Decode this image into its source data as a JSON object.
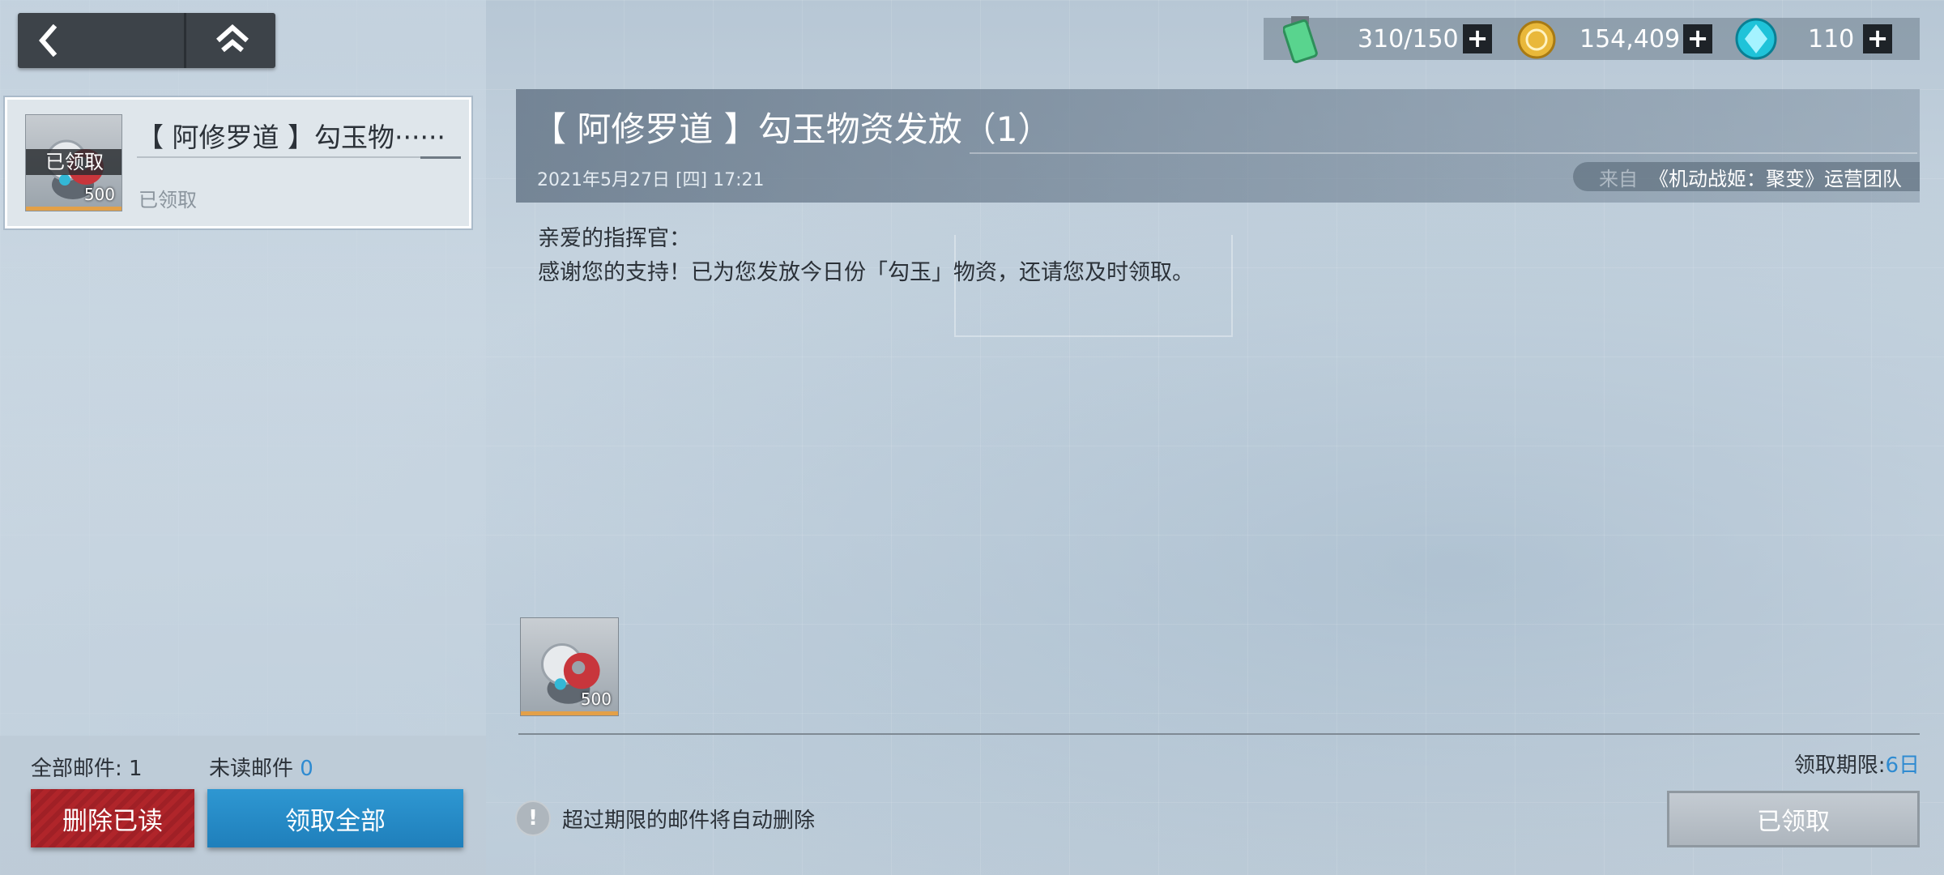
{
  "left": {
    "mail_list": [
      {
        "title": "【 阿修罗道 】勾玉物······",
        "tag": "已领取",
        "quantity": "500",
        "status": "已领取"
      }
    ],
    "footer": {
      "total_label": "全部邮件: 1",
      "unread_label": "未读邮件",
      "unread_count": "0",
      "delete_read_label": "删除已读",
      "claim_all_label": "领取全部"
    }
  },
  "resources": {
    "energy": {
      "value": "310/150",
      "icon": "green-battery-icon"
    },
    "coins": {
      "value": "154,409",
      "icon": "gold-coin-icon"
    },
    "crystals": {
      "value": "110",
      "icon": "cyan-crystal-icon"
    },
    "plus": "+"
  },
  "mail": {
    "title": "【 阿修罗道 】勾玉物资发放（1）",
    "date": "2021年5月27日 [四]   17:21",
    "from_label": "来自",
    "sender": "《机动战姬：聚变》运营团队",
    "greeting": "亲爱的指挥官：",
    "body": "感谢您的支持！已为您发放今日份「勾玉」物资，还请您及时领取。",
    "reward_quantity": "500",
    "deadline_label": "领取期限:",
    "deadline_value": "6日",
    "notice": "超过期限的邮件将自动删除",
    "claimed_button": "已领取"
  },
  "colors": {
    "accent_blue": "#2f8bd1",
    "delete_red": "#b0252a",
    "progress_orange": "#e3a048"
  }
}
